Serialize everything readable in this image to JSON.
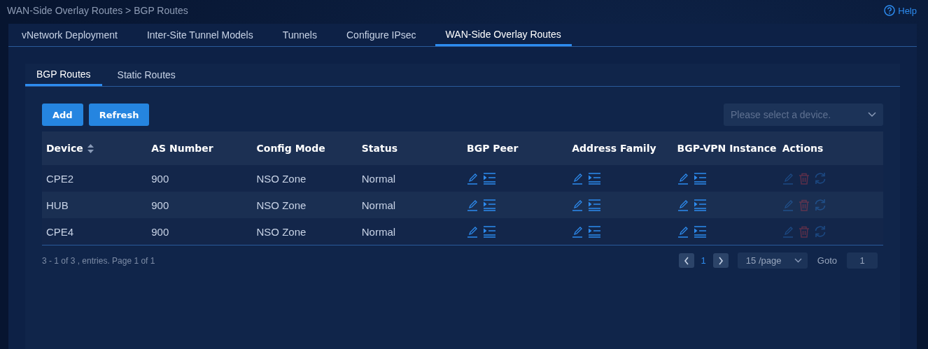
{
  "breadcrumb": "WAN-Side Overlay Routes > BGP Routes",
  "help": "Help",
  "tabs": [
    {
      "label": "vNetwork Deployment",
      "selected": false
    },
    {
      "label": "Inter-Site Tunnel Models",
      "selected": false
    },
    {
      "label": "Tunnels",
      "selected": false
    },
    {
      "label": "Configure IPsec",
      "selected": false
    },
    {
      "label": "WAN-Side Overlay Routes",
      "selected": true
    }
  ],
  "subtabs": [
    {
      "label": "BGP Routes",
      "selected": true
    },
    {
      "label": "Static Routes",
      "selected": false
    }
  ],
  "buttons": [
    "Add",
    "Refresh"
  ],
  "device_select": {
    "placeholder": "Please select a device."
  },
  "table": {
    "columns": [
      "Device",
      "AS Number",
      "Config Mode",
      "Status",
      "BGP Peer",
      "Address Family",
      "BGP-VPN Instance",
      "Actions"
    ],
    "rows": [
      {
        "device": "CPE2",
        "as_number": "900",
        "config_mode": "NSO Zone",
        "status": "Normal",
        "actions_disabled": true
      },
      {
        "device": "HUB",
        "as_number": "900",
        "config_mode": "NSO Zone",
        "status": "Normal",
        "actions_disabled": true
      },
      {
        "device": "CPE4",
        "as_number": "900",
        "config_mode": "NSO Zone",
        "status": "Normal",
        "actions_disabled": true
      }
    ]
  },
  "pagination": {
    "summary": "3 - 1 of 3 , entries. Page 1 of 1",
    "current_page": "1",
    "page_size": "15 /page",
    "goto_label": "Goto",
    "goto_value": "1"
  }
}
